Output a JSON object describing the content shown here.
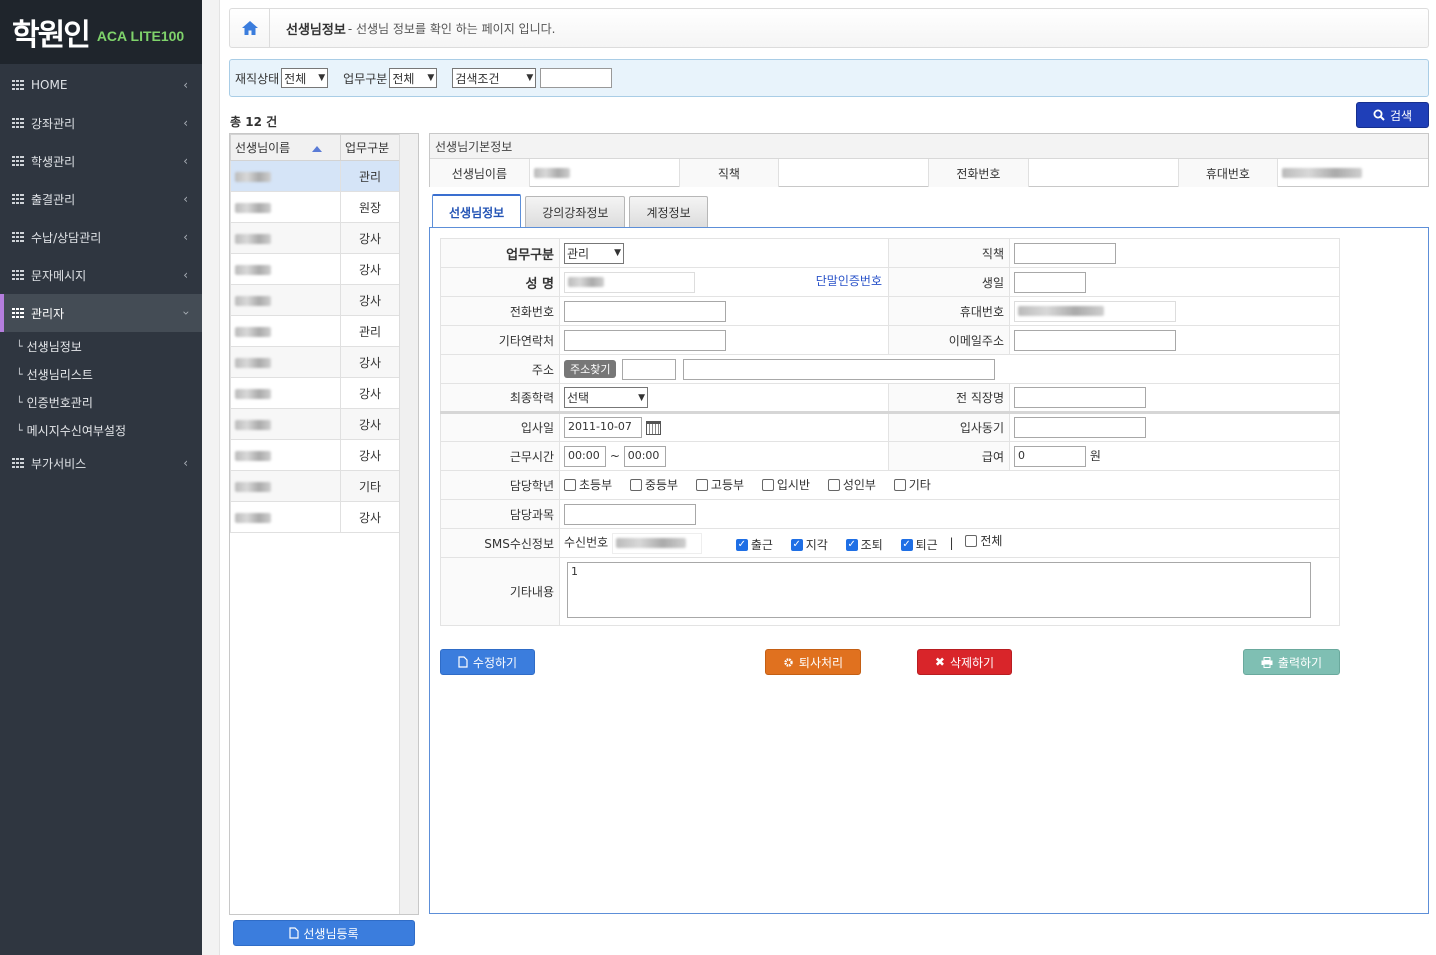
{
  "logo": {
    "main": "학원인",
    "sub": "ACA LITE100"
  },
  "sidebar": {
    "items": [
      {
        "label": "HOME"
      },
      {
        "label": "강좌관리"
      },
      {
        "label": "학생관리"
      },
      {
        "label": "출결관리"
      },
      {
        "label": "수납/상담관리"
      },
      {
        "label": "문자메시지"
      },
      {
        "label": "관리자"
      },
      {
        "label": "부가서비스"
      }
    ],
    "subitems": [
      {
        "label": "선생님정보"
      },
      {
        "label": "선생님리스트"
      },
      {
        "label": "인증번호관리"
      },
      {
        "label": "메시지수신여부설정"
      }
    ]
  },
  "header": {
    "title": "선생님정보",
    "desc": "- 선생님 정보를 확인 하는 페이지 입니다."
  },
  "filters": {
    "status_label": "재직상태",
    "status_value": "전체",
    "job_label": "업무구분",
    "job_value": "전체",
    "cond_value": "검색조건",
    "search_value": ""
  },
  "search_button": "검색",
  "total": "총 12 건",
  "list": {
    "col_name": "선생님이름",
    "col_role": "업무구분",
    "rows": [
      {
        "role": "관리"
      },
      {
        "role": "원장"
      },
      {
        "role": "강사"
      },
      {
        "role": "강사"
      },
      {
        "role": "강사"
      },
      {
        "role": "관리"
      },
      {
        "role": "강사"
      },
      {
        "role": "강사"
      },
      {
        "role": "강사"
      },
      {
        "role": "강사"
      },
      {
        "role": "기타"
      },
      {
        "role": "강사"
      }
    ]
  },
  "register_button": "선생님등록",
  "basic": {
    "header": "선생님기본정보",
    "name_label": "선생님이름",
    "position_label": "직책",
    "phone_label": "전화번호",
    "mobile_label": "휴대번호"
  },
  "tabs": [
    "선생님정보",
    "강의강좌정보",
    "계정정보"
  ],
  "form": {
    "job_label": "업무구분",
    "job_value": "관리",
    "position_label": "직책",
    "name_label": "성 명",
    "auth_link": "단말인증번호",
    "birth_label": "생일",
    "phone_label": "전화번호",
    "mobile_label": "휴대번호",
    "other_contact_label": "기타연락처",
    "email_label": "이메일주소",
    "address_label": "주소",
    "address_button": "주소찾기",
    "education_label": "최종학력",
    "education_value": "선택",
    "prev_job_label": "전 직장명",
    "join_date_label": "입사일",
    "join_date_value": "2011-10-07",
    "join_reason_label": "입사동기",
    "work_time_label": "근무시간",
    "work_start": "00:00",
    "tilde": "~",
    "work_end": "00:00",
    "salary_label": "급여",
    "salary_value": "0",
    "salary_unit": "원",
    "grade_label": "담당학년",
    "grades": [
      "초등부",
      "중등부",
      "고등부",
      "입시반",
      "성인부",
      "기타"
    ],
    "subject_label": "담당과목",
    "sms_label": "SMS수신정보",
    "sms_number_label": "수신번호",
    "sms_options": [
      {
        "label": "출근",
        "checked": true
      },
      {
        "label": "지각",
        "checked": true
      },
      {
        "label": "조퇴",
        "checked": true
      },
      {
        "label": "퇴근",
        "checked": true
      }
    ],
    "sms_divider": "|",
    "sms_all": "전체",
    "memo_label": "기타내용",
    "memo_value": "1"
  },
  "buttons": {
    "edit": "수정하기",
    "resign": "퇴사처리",
    "delete": "삭제하기",
    "print": "출력하기"
  },
  "colors": {
    "sidebar": "#2f3640",
    "accent": "#1f3fb8",
    "edit": "#3b7ddd",
    "resign": "#e0711f",
    "delete": "#d9252a",
    "print": "#7fbfb3"
  }
}
